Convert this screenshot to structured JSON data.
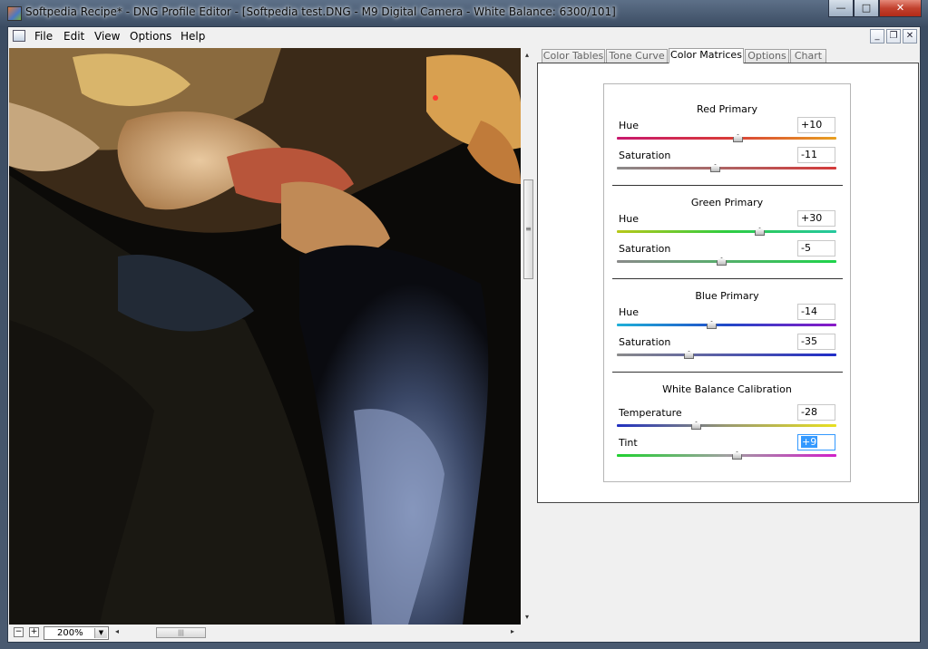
{
  "window": {
    "title": "Softpedia Recipe* - DNG Profile Editor - [Softpedia test.DNG  - M9 Digital Camera - White Balance: 6300/101]",
    "controls": {
      "minimize": "—",
      "maximize": "□",
      "close": "✕"
    }
  },
  "menu": {
    "items": [
      "File",
      "Edit",
      "View",
      "Options",
      "Help"
    ]
  },
  "mdi_controls": {
    "minimize": "_",
    "restore": "❐",
    "close": "✕"
  },
  "image_view": {
    "zoom": "200%",
    "zoom_out_label": "−",
    "zoom_in_label": "+",
    "scroll_left": "◂",
    "scroll_right": "▸",
    "scroll_up": "▴",
    "scroll_down": "▾"
  },
  "tabs": [
    "Color Tables",
    "Tone Curve",
    "Color Matrices",
    "Options",
    "Chart"
  ],
  "active_tab": "Color Matrices",
  "sections": [
    {
      "title": "Red Primary",
      "controls": [
        {
          "label": "Hue",
          "value": "+10",
          "level": 10,
          "track": "linear-gradient(90deg,#c8186e,#d83a3a,#e8a020)"
        },
        {
          "label": "Saturation",
          "value": "-11",
          "level": -11,
          "track": "linear-gradient(90deg,#8a8a8a,#d43a3a)"
        }
      ]
    },
    {
      "title": "Green Primary",
      "controls": [
        {
          "label": "Hue",
          "value": "+30",
          "level": 30,
          "track": "linear-gradient(90deg,#b8c81a,#2ecc40,#25c8a0)"
        },
        {
          "label": "Saturation",
          "value": "-5",
          "level": -5,
          "track": "linear-gradient(90deg,#8a8a8a,#1ed44a)"
        }
      ]
    },
    {
      "title": "Blue Primary",
      "controls": [
        {
          "label": "Hue",
          "value": "-14",
          "level": -14,
          "track": "linear-gradient(90deg,#1fb0d8,#2048c8,#8a18c8)"
        },
        {
          "label": "Saturation",
          "value": "-35",
          "level": -35,
          "track": "linear-gradient(90deg,#8a8a8a,#1f2cc8)"
        }
      ]
    },
    {
      "title": "White Balance Calibration",
      "controls": [
        {
          "label": "Temperature",
          "value": "-28",
          "level": -28,
          "track": "linear-gradient(90deg,#2030c0,#9a9a70,#e8e020)"
        },
        {
          "label": "Tint",
          "value": "+9",
          "level": 9,
          "selected": true,
          "track": "linear-gradient(90deg,#20d030,#a0a0a0,#d020c8)"
        }
      ]
    }
  ],
  "slider_range": [
    -100,
    100
  ]
}
